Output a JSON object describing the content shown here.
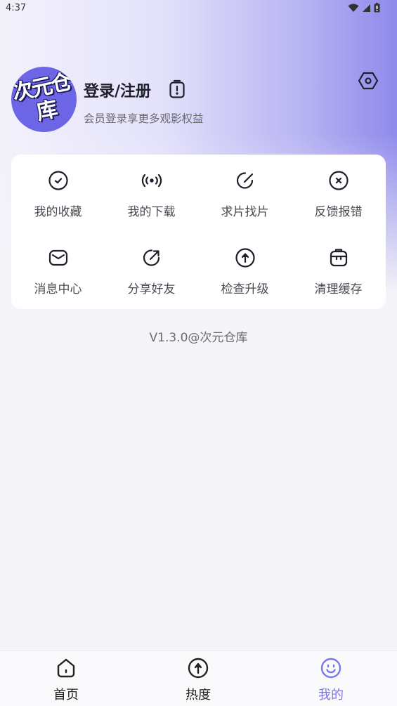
{
  "status_bar": {
    "time": "4:37"
  },
  "profile": {
    "avatar_text": "次元仓库",
    "login_title": "登录/注册",
    "subtitle": "会员登录享更多观影权益"
  },
  "menu": [
    {
      "icon": "check-circle-icon",
      "label": "我的收藏"
    },
    {
      "icon": "broadcast-icon",
      "label": "我的下载"
    },
    {
      "icon": "edit-icon",
      "label": "求片找片"
    },
    {
      "icon": "close-circle-icon",
      "label": "反馈报错"
    },
    {
      "icon": "mail-icon",
      "label": "消息中心"
    },
    {
      "icon": "share-icon",
      "label": "分享好友"
    },
    {
      "icon": "upgrade-icon",
      "label": "检查升级"
    },
    {
      "icon": "trash-icon",
      "label": "清理缓存"
    }
  ],
  "version": "V1.3.0@次元仓库",
  "bottom_nav": [
    {
      "icon": "home-icon",
      "label": "首页",
      "active": false
    },
    {
      "icon": "hot-icon",
      "label": "热度",
      "active": false
    },
    {
      "icon": "smile-icon",
      "label": "我的",
      "active": true
    }
  ],
  "colors": {
    "accent": "#7b76e8",
    "avatar_bg": "#6c66e6"
  }
}
